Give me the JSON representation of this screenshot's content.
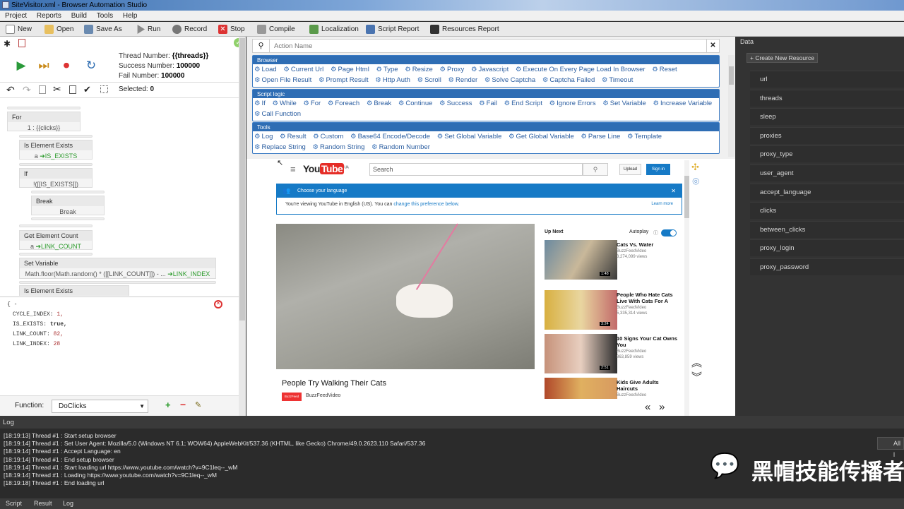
{
  "window": {
    "title": "SiteVisitor.xml - Browser Automation Studio"
  },
  "menu": [
    "Project",
    "Reports",
    "Build",
    "Tools",
    "Help"
  ],
  "toolbar": {
    "new": "New",
    "open": "Open",
    "save_as": "Save As",
    "run": "Run",
    "record": "Record",
    "stop": "Stop",
    "compile": "Compile",
    "localization": "Localization",
    "script_report": "Script Report",
    "resources_report": "Resources Report"
  },
  "stats": {
    "thread_label": "Thread Number:",
    "thread_value": "{{threads}}",
    "success_label": "Success Number:",
    "success_value": "100000",
    "fail_label": "Fail Number:",
    "fail_value": "100000",
    "selected_label": "Selected:",
    "selected_value": "0"
  },
  "blocks": {
    "for_title": "For",
    "for_body": "1 : {{clicks}}",
    "exists_title": "Is Element Exists",
    "exists_prefix": "a",
    "exists_var": "IS_EXISTS",
    "if_title": "If",
    "if_body": "!([[IS_EXISTS]])",
    "break_title": "Break",
    "break_body": "Break",
    "count_title": "Get Element Count",
    "count_prefix": "a",
    "count_var": "LINK_COUNT",
    "setvar_title": "Set Variable",
    "setvar_body": "Math.floor(Math.random() * ([[LINK_COUNT]]) - ...",
    "setvar_var": "LINK_INDEX",
    "exists2_title": "Is Element Exists"
  },
  "vars": {
    "open": "{ -",
    "l1k": "CYCLE_INDEX:",
    "l1v": "1,",
    "l2k": "IS_EXISTS:",
    "l2v": "true,",
    "l3k": "LINK_COUNT:",
    "l3v": "82,",
    "l4k": "LINK_INDEX:",
    "l4v": "28"
  },
  "function": {
    "label": "Function:",
    "value": "DoClicks"
  },
  "actions": {
    "search_placeholder": "Action Name",
    "groups": [
      {
        "title": "Browser",
        "items": [
          "Load",
          "Current Url",
          "Page Html",
          "Type",
          "Resize",
          "Proxy",
          "Javascript",
          "Execute On Every Page Load In Browser",
          "Reset",
          "Open File Result",
          "Prompt Result",
          "Http Auth",
          "Scroll",
          "Render",
          "Solve Captcha",
          "Captcha Failed",
          "Timeout"
        ]
      },
      {
        "title": "Script logic",
        "items": [
          "If",
          "While",
          "For",
          "Foreach",
          "Break",
          "Continue",
          "Success",
          "Fail",
          "End Script",
          "Ignore Errors",
          "Set Variable",
          "Increase Variable",
          "Call Function"
        ]
      },
      {
        "title": "Tools",
        "items": [
          "Log",
          "Result",
          "Custom",
          "Base64 Encode/Decode",
          "Set Global Variable",
          "Get Global Variable",
          "Parse Line",
          "Template",
          "Replace String",
          "Random String",
          "Random Number"
        ]
      }
    ]
  },
  "youtube": {
    "logo_you": "You",
    "logo_tube": "Tube",
    "logo_sup": "UA",
    "search_placeholder": "Search",
    "upload": "Upload",
    "signin": "Sign in",
    "lang_title": "Choose your language",
    "lang_text": "You're viewing YouTube in English (US). You can",
    "lang_link": "change this preference below.",
    "learn_more": "Learn more",
    "video_title": "People Try Walking Their Cats",
    "channel": "BuzzFeedVideo",
    "channel_badge": "BuzzFeed",
    "up_next": "Up Next",
    "autoplay": "Autoplay",
    "side": [
      {
        "title": "Cats Vs. Water",
        "channel": "BuzzFeedVideo",
        "views": "3,274,099 views",
        "time": "1:48"
      },
      {
        "title": "People Who Hate Cats Live With Cats For A",
        "channel": "BuzzFeedVideo",
        "views": "5,335,314 views",
        "time": "3:24"
      },
      {
        "title": "10 Signs Your Cat Owns You",
        "channel": "BuzzFeedVideo",
        "views": "863,859 views",
        "time": "2:51"
      },
      {
        "title": "Kids Give Adults Haircuts",
        "channel": "BuzzFeedVideo",
        "views": "6,037,550 views",
        "time": ""
      }
    ]
  },
  "data_panel": {
    "title": "Data",
    "create": "+ Create New Resource",
    "items": [
      "url",
      "threads",
      "sleep",
      "proxies",
      "proxy_type",
      "user_agent",
      "accept_language",
      "clicks",
      "between_clicks",
      "proxy_login",
      "proxy_password"
    ]
  },
  "log": {
    "title": "Log",
    "all_button": "All l",
    "lines": [
      "[18:19:13] Thread #1 : Start setup browser",
      "[18:19:14] Thread #1 : Set User Agent: Mozilla/5.0 (Windows NT 6.1; WOW64) AppleWebKit/537.36 (KHTML, like Gecko) Chrome/49.0.2623.110 Safari/537.36",
      "[18:19:14] Thread #1 : Accept Language: en",
      "[18:19:14] Thread #1 : End setup browser",
      "[18:19:14] Thread #1 : Start loading url https://www.youtube.com/watch?v=9C1leq--_wM",
      "[18:19:14] Thread #1 : Loading https://www.youtube.com/watch?v=9C1leq--_wM",
      "[18:19:18] Thread #1 : End loading url"
    ]
  },
  "watermark": "黑帽技能传播者",
  "tabs": [
    "Script",
    "Result",
    "Log"
  ]
}
